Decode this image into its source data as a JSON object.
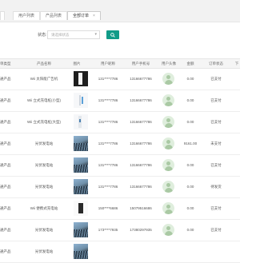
{
  "tabs": [
    {
      "label": "首页",
      "active": false
    },
    {
      "label": "用户列表",
      "active": false
    },
    {
      "label": "产品列表",
      "active": false
    },
    {
      "label": "全部订单",
      "active": true,
      "close": "×"
    }
  ],
  "filter": {
    "label": "状态:",
    "placeholder": "请选择状态",
    "search_icon": "search-icon"
  },
  "table": {
    "headers": [
      "单类型",
      "产品名称",
      "图片",
      "用户昵称",
      "用户手机号",
      "用户头像",
      "金额",
      "订单状态",
      "下"
    ],
    "rows": [
      {
        "type": "通产品",
        "name": "Wii 太阳能广告机",
        "image": "white-device",
        "nick": "131****7786",
        "phone": "13166677786",
        "amount": "0.00",
        "status": "已支付"
      },
      {
        "type": "通产品",
        "name": "Wii 立式充电桩(小型)",
        "image": "white-charger-small",
        "nick": "131****7786",
        "phone": "13166677786",
        "amount": "0.00",
        "status": "已支付"
      },
      {
        "type": "通产品",
        "name": "Wii 立式充电桩(大型)",
        "image": "white-charger-large",
        "nick": "131****7786",
        "phone": "13166677786",
        "amount": "0.00",
        "status": "已支付"
      },
      {
        "type": "通产品",
        "name": "光伏发电站",
        "image": "solar-field",
        "nick": "131****7786",
        "phone": "13166677786",
        "amount": "9161.00",
        "status": "未支付"
      },
      {
        "type": "通产品",
        "name": "光伏发电站",
        "image": "solar-field",
        "nick": "131****7786",
        "phone": "13166677786",
        "amount": "0.00",
        "status": "已支付"
      },
      {
        "type": "通产品",
        "name": "光伏发电站",
        "image": "solar-field",
        "nick": "131****7786",
        "phone": "13166677786",
        "amount": "0.00",
        "status": "待发货"
      },
      {
        "type": "通产品",
        "name": "Wii 便携式充电站",
        "image": "portable-station",
        "nick": "150****6686",
        "phone": "15079516686",
        "amount": "0.00",
        "status": "已支付"
      },
      {
        "type": "通产品",
        "name": "光伏发电站",
        "image": "solar-field",
        "nick": "173****7935",
        "phone": "17380297935",
        "amount": "0.00",
        "status": "已支付"
      },
      {
        "type": "通产品",
        "name": "光伏发电站",
        "image": "solar-field",
        "nick": "",
        "phone": "",
        "amount": "",
        "status": ""
      }
    ]
  },
  "colors": {
    "accent": "#119b88"
  }
}
